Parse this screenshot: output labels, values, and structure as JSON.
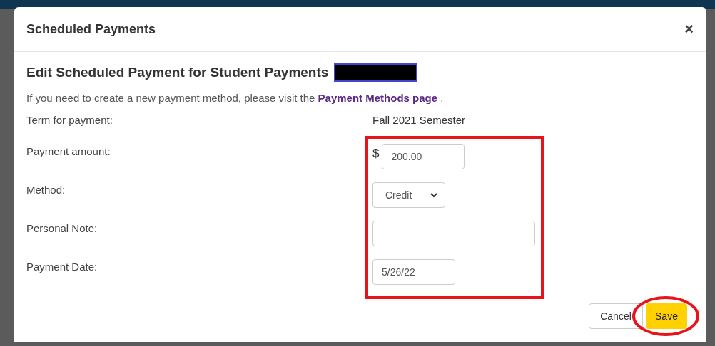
{
  "modal": {
    "title": "Scheduled Payments",
    "close": "×"
  },
  "heading": {
    "text": "Edit Scheduled Payment for Student Payments",
    "redacted": true
  },
  "form_highlight": {
    "kind": "rectangle"
  },
  "save_highlight": {
    "kind": "ellipse"
  },
  "info": {
    "before": "If you need to create a new payment method, please visit the",
    "link": "Payment Methods page",
    "after": "."
  },
  "term": {
    "label": "Term for payment:",
    "value": "Fall 2021 Semester"
  },
  "fields": [
    {
      "kind": "amount",
      "label": "Payment amount:",
      "prefix": "$",
      "value": "200.00"
    },
    {
      "kind": "select",
      "label": "Method:",
      "value": "Credit"
    },
    {
      "kind": "input",
      "label": "Personal Note:"
    },
    {
      "kind": "input",
      "label": "Payment Date:",
      "value": "5/26/22"
    }
  ],
  "buttons": [
    {
      "kind": "secondary",
      "label": "Cancel"
    },
    {
      "kind": "primary",
      "label": "Save"
    }
  ]
}
